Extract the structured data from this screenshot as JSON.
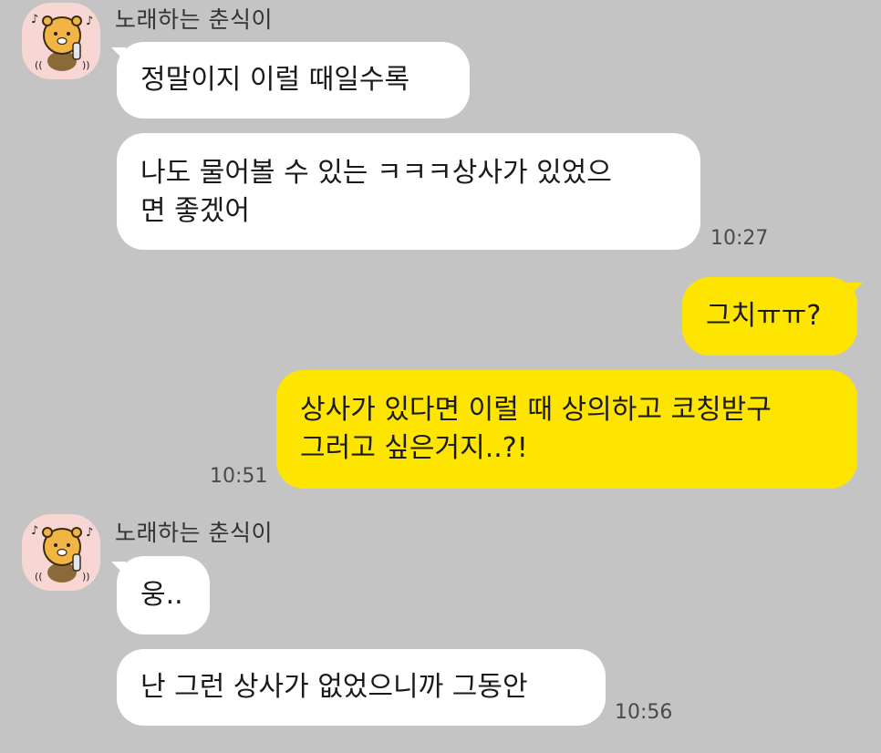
{
  "chat": {
    "sender_name": "노래하는 춘식이",
    "group1": {
      "messages": [
        {
          "text": "정말이지 이럴 때일수록"
        },
        {
          "text": "나도 물어볼 수 있는 ㅋㅋㅋ상사가 있었으면 좋겠어",
          "line1": "나도 물어볼 수 있는 ㅋㅋㅋ상사가 있었으",
          "line2": "면 좋겠어"
        }
      ],
      "time": "10:27"
    },
    "mine": {
      "messages": [
        {
          "text": "그치ㅠㅠ?"
        },
        {
          "text": "상사가 있다면 이럴 때 상의하고 코칭받구 그러고 싶은거지..?!",
          "line1": "상사가 있다면 이럴 때 상의하고 코칭받구",
          "line2": "그러고 싶은거지..?!"
        }
      ],
      "time": "10:51"
    },
    "group2": {
      "messages": [
        {
          "text": "웅.."
        },
        {
          "text": "난 그런 상사가 없었으니까 그동안"
        }
      ],
      "time": "10:56"
    }
  },
  "colors": {
    "background": "#c4c4c4",
    "incoming_bubble": "#ffffff",
    "outgoing_bubble": "#fee500",
    "avatar_bg": "#f7d6d3"
  },
  "icons": {
    "avatar": "choonsik-singing-character-icon"
  }
}
